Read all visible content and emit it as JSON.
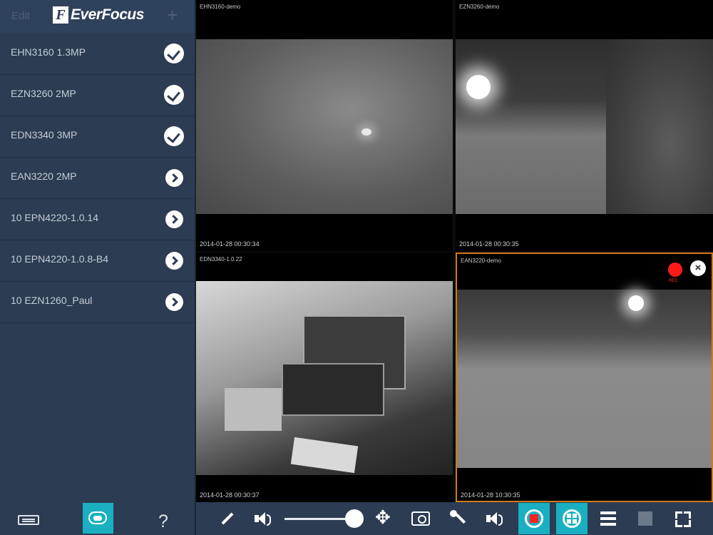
{
  "sidebar": {
    "edit_label": "Edit",
    "logo_mark": "F",
    "logo_text": "EverFocus",
    "add_label": "+",
    "devices": [
      {
        "label": "EHN3160 1.3MP",
        "state": "checked"
      },
      {
        "label": "EZN3260 2MP",
        "state": "checked"
      },
      {
        "label": "EDN3340 3MP",
        "state": "checked"
      },
      {
        "label": "EAN3220 2MP",
        "state": "arrow"
      },
      {
        "label": "10 EPN4220-1.0.14",
        "state": "arrow"
      },
      {
        "label": "10 EPN4220-1.0.8-B4",
        "state": "arrow"
      },
      {
        "label": "10 EZN1260_Paul",
        "state": "arrow"
      }
    ],
    "help_label": "?"
  },
  "cameras": [
    {
      "name": "EHN3160-demo",
      "timestamp": "2014-01-28 00:30:34"
    },
    {
      "name": "EZN3260-demo",
      "timestamp": "2014-01-28 00:30:35"
    },
    {
      "name": "EDN3340-1.0.22",
      "timestamp": "2014-01-28 00:30:37"
    },
    {
      "name": "EAN3220-demo",
      "timestamp": "2014-01-28 10:30:35",
      "rec_label": "REC",
      "selected": true
    }
  ],
  "toolbar": {
    "volume": 0.95
  },
  "colors": {
    "sidebar_bg": "#2b3c53",
    "accent": "#1ab0c2",
    "selection_border": "#d07a17",
    "record_red": "#ff1a1a"
  }
}
